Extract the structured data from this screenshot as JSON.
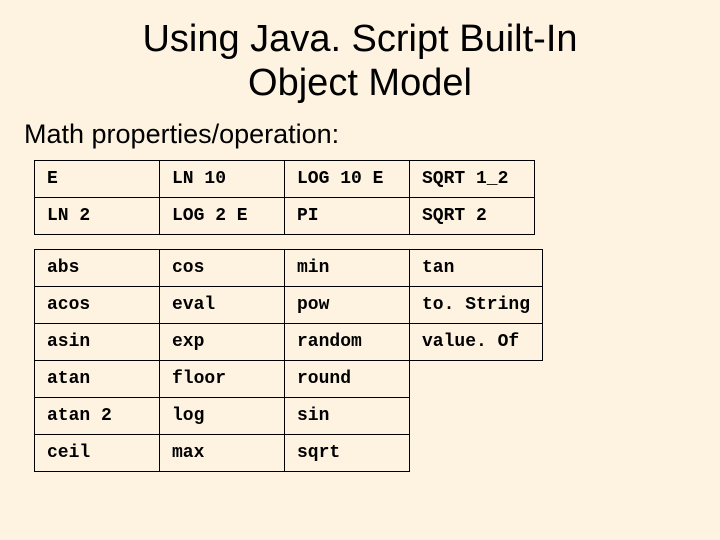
{
  "title_line1": "Using Java. Script Built-In",
  "title_line2": "Object Model",
  "subheading": "Math properties/operation:",
  "props": {
    "r0": {
      "c0": "E",
      "c1": "LN 10",
      "c2": "LOG 10 E",
      "c3": "SQRT 1_2"
    },
    "r1": {
      "c0": "LN 2",
      "c1": "LOG 2 E",
      "c2": "PI",
      "c3": "SQRT 2"
    }
  },
  "methods": {
    "r0": {
      "c0": "abs",
      "c1": "cos",
      "c2": "min",
      "c3": "tan"
    },
    "r1": {
      "c0": "acos",
      "c1": "eval",
      "c2": "pow",
      "c3": "to. String"
    },
    "r2": {
      "c0": "asin",
      "c1": "exp",
      "c2": "random",
      "c3": "value. Of"
    },
    "r3": {
      "c0": "atan",
      "c1": "floor",
      "c2": "round"
    },
    "r4": {
      "c0": "atan 2",
      "c1": "log",
      "c2": "sin"
    },
    "r5": {
      "c0": "ceil",
      "c1": "max",
      "c2": "sqrt"
    }
  }
}
